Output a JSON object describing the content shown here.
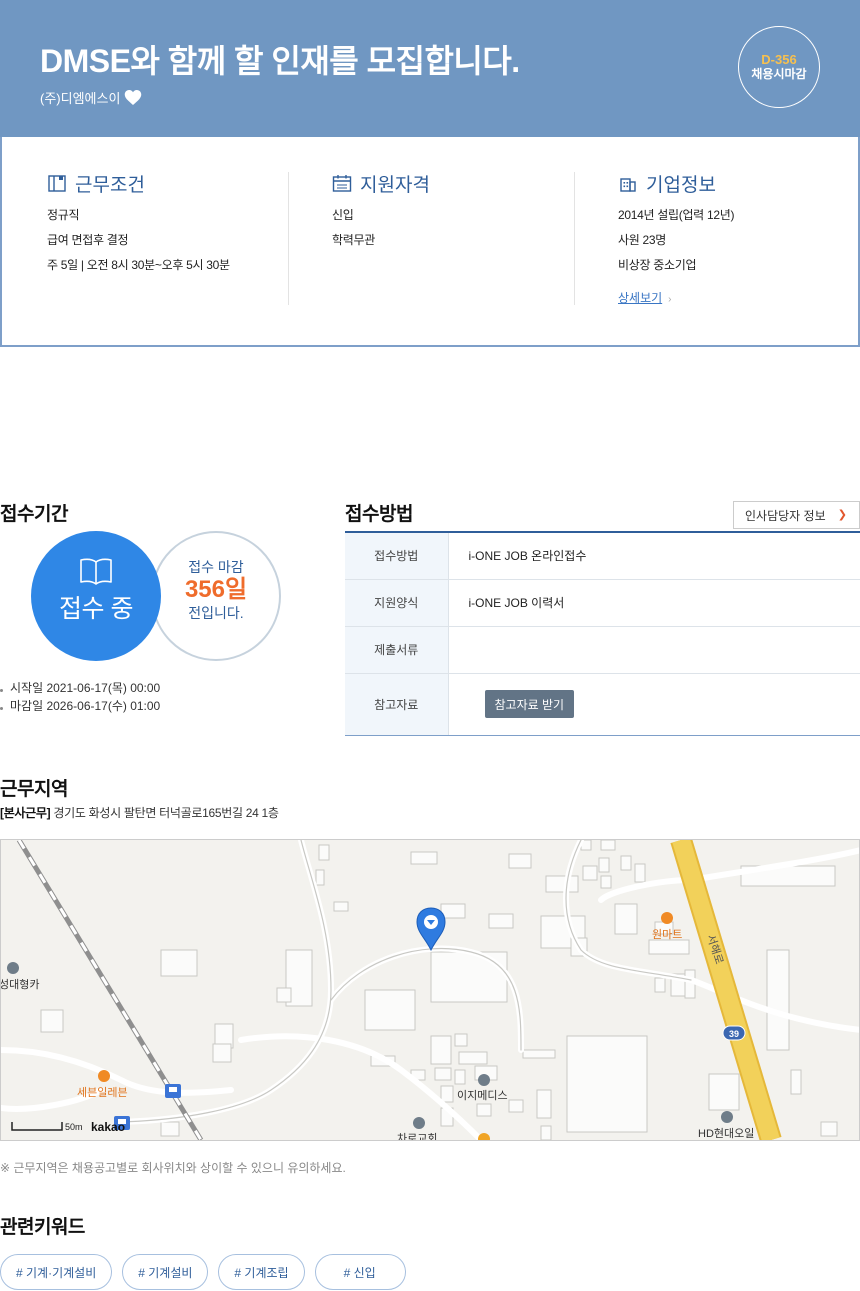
{
  "header": {
    "title": "DMSE와 함께 할 인재를 모집합니다.",
    "company": "(주)디엠에스이",
    "dday": "D-356",
    "dday_label": "채용시마감"
  },
  "conditions": {
    "work": {
      "title": "근무조건",
      "items": [
        "정규직",
        "급여 면접후 결정",
        "주 5일 | 오전 8시 30분~오후 5시 30분"
      ]
    },
    "qualification": {
      "title": "지원자격",
      "items": [
        "신입",
        "학력무관"
      ]
    },
    "company": {
      "title": "기업정보",
      "items": [
        "2014년 설립(업력 12년)",
        "사원 23명",
        "비상장 중소기업"
      ],
      "detail_link": "상세보기"
    }
  },
  "period": {
    "title": "접수기간",
    "status": "접수 중",
    "deadline_label": "접수 마감",
    "deadline_days": "356일",
    "deadline_suffix": "전입니다.",
    "start": "시작일 2021-06-17(목) 00:00",
    "end": "마감일 2026-06-17(수) 01:00"
  },
  "method": {
    "title": "접수방법",
    "hr_button": "인사담당자 정보",
    "rows": [
      {
        "label": "접수방법",
        "value": "i-ONE JOB 온라인접수"
      },
      {
        "label": "지원양식",
        "value": "i-ONE JOB 이력서"
      },
      {
        "label": "제출서류",
        "value": ""
      },
      {
        "label": "참고자료",
        "button": "참고자료 받기"
      }
    ]
  },
  "region": {
    "title": "근무지역",
    "address_tag": "[본사근무]",
    "address": "경기도 화성시 팔탄면 터넉골로165번길 24 1층",
    "note": "※ 근무지역은 채용공고별로 회사위치와 상이할 수 있으니 유의하세요.",
    "map": {
      "labels": [
        "원마트",
        "성대형카",
        "세븐일레븐",
        "이지메디스",
        "HD현대오일",
        "서해로",
        "39",
        "차로교회"
      ],
      "scale": "50m",
      "brand": "kakao"
    }
  },
  "keywords": {
    "title": "관련키워드",
    "items": [
      "# 기계·기계설비",
      "# 기계설비",
      "# 기계조립",
      "# 신입"
    ]
  },
  "colors": {
    "banner": "#7097c2",
    "accent_blue": "#2f87e6",
    "deadline_orange": "#ef6c2c",
    "dday_yellow": "#f7c04f",
    "road_yellow": "#f2d15a"
  }
}
